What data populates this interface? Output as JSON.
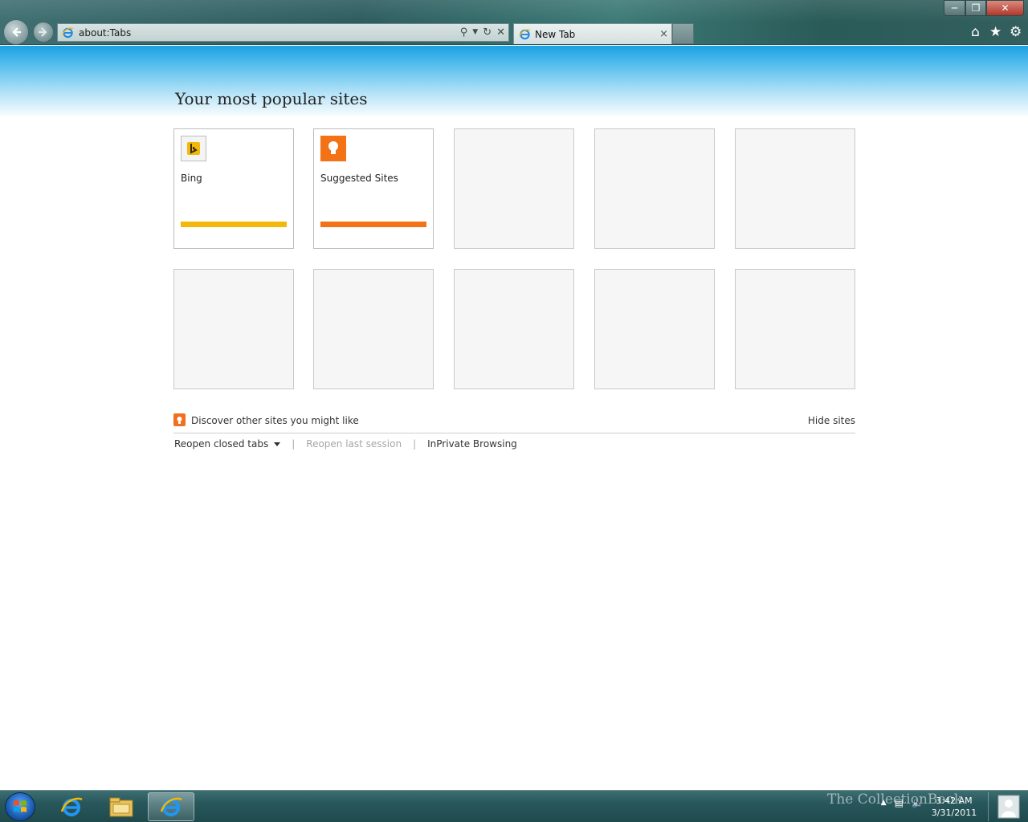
{
  "browser": {
    "address": "about:Tabs",
    "tab_title": "New Tab",
    "tab_close_glyph": "×",
    "addr_tools": [
      "search-icon",
      "dropdown-icon",
      "refresh-icon",
      "stop-icon"
    ],
    "right_tools": [
      "home-icon",
      "favorites-icon",
      "tools-icon"
    ],
    "window_controls": [
      "minimize",
      "maximize",
      "close"
    ]
  },
  "page": {
    "title": "Your most popular sites",
    "tiles": [
      {
        "label": "Bing",
        "icon": "bing-icon",
        "bar_color": "#f2b90c"
      },
      {
        "label": "Suggested Sites",
        "icon": "suggested-sites-icon",
        "bar_color": "#f47216"
      }
    ],
    "empty_tiles": 8,
    "discover_text": "Discover other sites you might like",
    "hide_sites": "Hide sites",
    "links": {
      "reopen_closed_tabs": "Reopen closed tabs",
      "reopen_last_session": "Reopen last session",
      "inprivate": "InPrivate Browsing",
      "separator": "|"
    }
  },
  "taskbar": {
    "clock_time": "3:42 AM",
    "clock_date": "3/31/2011",
    "pinned": [
      "internet-explorer-icon",
      "windows-explorer-icon",
      "internet-explorer-icon"
    ],
    "watermark": "The CollectionBook"
  },
  "colors": {
    "bing": "#f2b90c",
    "suggested": "#f47216",
    "header_blue": "#1ba1e2"
  }
}
